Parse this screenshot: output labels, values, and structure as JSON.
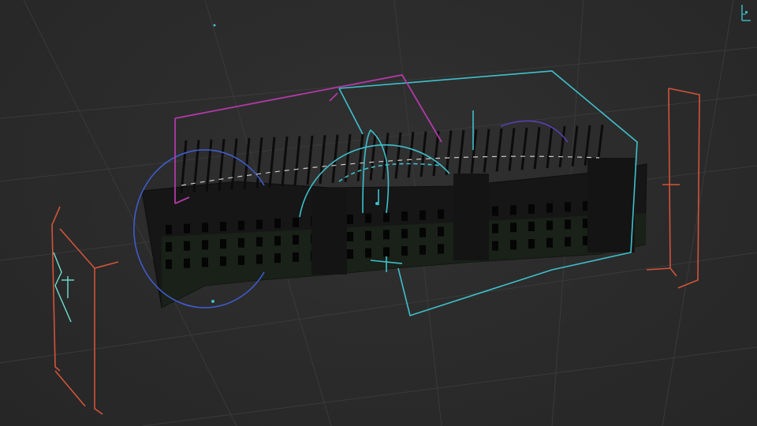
{
  "viewport": {
    "background": "#2b2b2b",
    "grid_color": "#3b3b3b"
  },
  "colors": {
    "camera_left": "#d2543a",
    "camera_right": "#d2543a",
    "cyan_path": "#3fc0cc",
    "magenta_path": "#b23aa8",
    "blue_orbit": "#3f5ccc",
    "teal_marker": "#4fd0a8",
    "building": "#151515"
  },
  "icons": {
    "orientation_gizmo": "axis-gizmo-icon"
  }
}
